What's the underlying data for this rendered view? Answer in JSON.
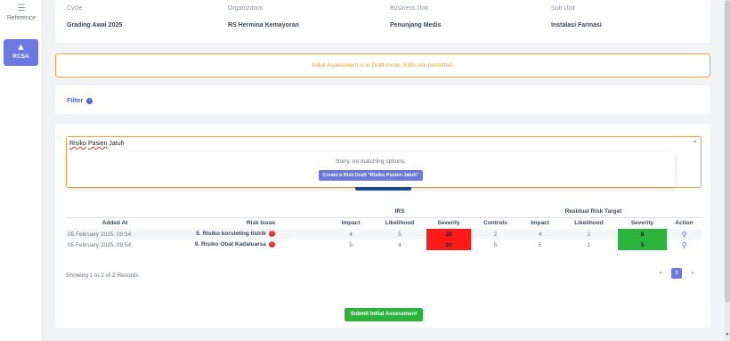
{
  "sidebar": {
    "reference": {
      "label": "Reference",
      "icon": "sliders-icon"
    },
    "rcsa": {
      "label": "RCSA",
      "icon": "warning-icon"
    }
  },
  "info": {
    "cycle": {
      "label": "Cycle",
      "value": "Grading Awal 2025"
    },
    "organization": {
      "label": "Organization",
      "value": "RS Hermina Kemayoran"
    },
    "business_unit": {
      "label": "Business Unit",
      "value": "Penunjang Medis"
    },
    "sub_unit": {
      "label": "Sub Unit",
      "value": "Instalasi Farmasi"
    }
  },
  "warning": "Initial Assessment is in Draft mode. Edits are permitted.",
  "filter": {
    "label": "Filter"
  },
  "search": {
    "value_word1": "Risiko",
    "value_word2": "Pasien",
    "value_word3": "Jatuh",
    "no_match": "Sorry, no matching options.",
    "create_label": "Create a Risk Draft \"Risiko Pasien Jatuh\""
  },
  "table": {
    "group_irs": "IRS",
    "group_residual": "Residual Risk Target",
    "headers": {
      "added_at": "Added At",
      "risk_issue": "Risk Issue",
      "impact": "Impact",
      "likelihood": "Likelihood",
      "severity": "Severity",
      "controls": "Controls",
      "r_impact": "Impact",
      "r_likelihood": "Likelihood",
      "r_severity": "Severity",
      "action": "Action"
    },
    "rows": [
      {
        "added_at": "05 February 2025, 09:54",
        "risk_issue": "5. Risiko korsleting listrik",
        "badge": "!",
        "impact": "4",
        "likelihood": "5",
        "severity": "20",
        "controls": "2",
        "r_impact": "4",
        "r_likelihood": "2",
        "r_severity": "8"
      },
      {
        "added_at": "05 February 2025, 09:54",
        "risk_issue": "9. Risiko Obat Kadaluarsa",
        "badge": "!",
        "impact": "5",
        "likelihood": "4",
        "severity": "20",
        "controls": "5",
        "r_impact": "5",
        "r_likelihood": "1",
        "r_severity": "5"
      }
    ]
  },
  "showing": "Showing 1 to 2 of 2 Records",
  "pager": {
    "prev": "«",
    "page": "1",
    "next": "»"
  },
  "submit_label": "Submit Initial Assessment",
  "colors": {
    "accent": "#6c7ae0",
    "warning": "#f0a23a",
    "severity_high": "#ff1a1a",
    "severity_low": "#2bb33b"
  }
}
